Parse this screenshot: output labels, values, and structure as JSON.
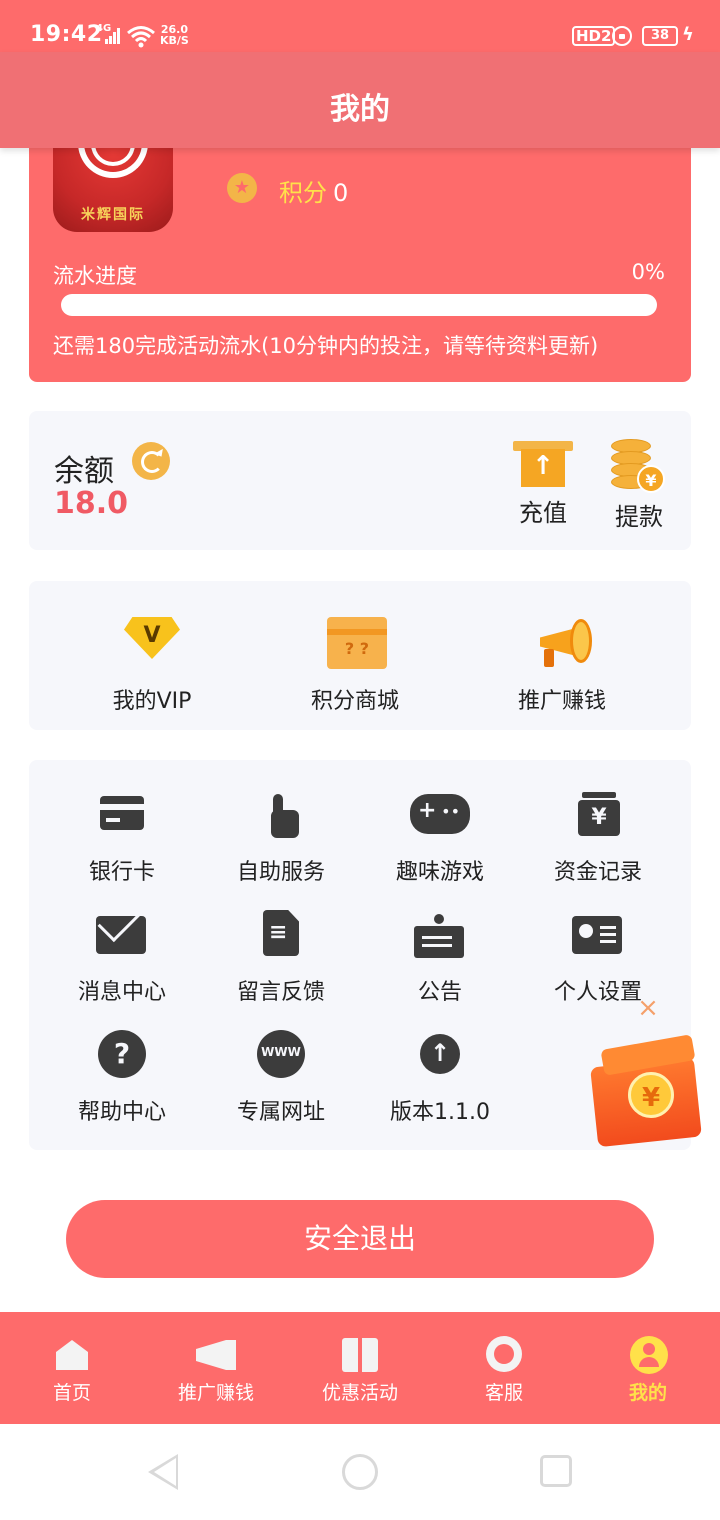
{
  "status_bar": {
    "time": "19:42",
    "signal": "4G",
    "net_speed": "26.0",
    "net_speed_unit": "KB/S",
    "hd_label": "HD2",
    "battery": "38"
  },
  "header": {
    "title": "我的"
  },
  "profile": {
    "avatar_text": "米辉国际",
    "points_label": "积分",
    "points_value": "0",
    "progress_label": "流水进度",
    "progress_percent_text": "0%",
    "progress_fraction": 0,
    "progress_note": "还需180完成活动流水(10分钟内的投注，请等待资料更新)"
  },
  "balance": {
    "label": "余额",
    "value": "18.0",
    "recharge_label": "充值",
    "withdraw_label": "提款"
  },
  "features": {
    "vip_label": "我的VIP",
    "shop_label": "积分商城",
    "promote_label": "推广赚钱"
  },
  "grid": {
    "items": [
      {
        "label": "银行卡",
        "icon": "bank-card-icon"
      },
      {
        "label": "自助服务",
        "icon": "hand-pointer-icon"
      },
      {
        "label": "趣味游戏",
        "icon": "gamepad-icon"
      },
      {
        "label": "资金记录",
        "icon": "money-box-icon"
      },
      {
        "label": "消息中心",
        "icon": "mail-icon"
      },
      {
        "label": "留言反馈",
        "icon": "edit-doc-icon"
      },
      {
        "label": "公告",
        "icon": "notice-board-icon"
      },
      {
        "label": "个人设置",
        "icon": "id-card-icon"
      },
      {
        "label": "帮助中心",
        "icon": "help-icon"
      },
      {
        "label": "专属网址",
        "icon": "globe-www-icon"
      },
      {
        "label": "版本1.1.0",
        "icon": "upload-icon"
      }
    ]
  },
  "logout": {
    "label": "安全退出"
  },
  "tabbar": {
    "items": [
      {
        "label": "首页",
        "icon": "home-icon"
      },
      {
        "label": "推广赚钱",
        "icon": "megaphone-icon"
      },
      {
        "label": "优惠活动",
        "icon": "gift-icon"
      },
      {
        "label": "客服",
        "icon": "headset-icon"
      },
      {
        "label": "我的",
        "icon": "user-icon"
      }
    ],
    "active_index": 4
  },
  "colors": {
    "primary": "#fe6b6b",
    "accent_yellow": "#ffe14a",
    "balance_value": "#f05a64",
    "card_bg": "#f6f7fb",
    "icon_dark": "#3c3c3c"
  }
}
